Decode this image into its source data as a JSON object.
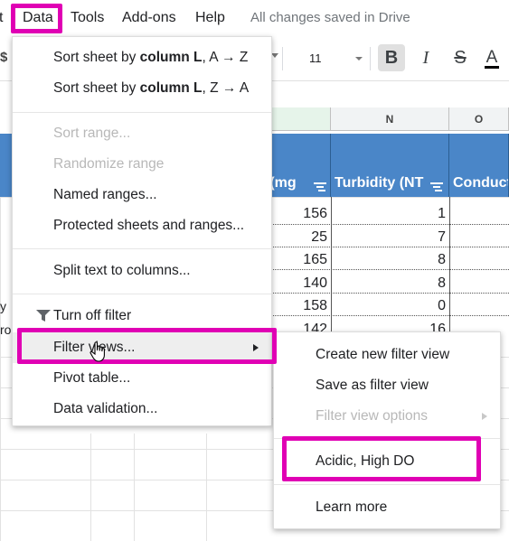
{
  "menubar": {
    "partial_left": "t",
    "items": [
      "Data",
      "Tools",
      "Add-ons",
      "Help"
    ],
    "status": "All changes saved in Drive"
  },
  "toolbar": {
    "currency": "$",
    "font_size": "11",
    "bold": "B",
    "italic": "I",
    "strike": "S",
    "text_color": "A"
  },
  "columns": {
    "n": "N",
    "o": "O"
  },
  "header_cells": {
    "m": "y (mg",
    "n": "Turbidity (NT",
    "o": "Conduct"
  },
  "rows": [
    {
      "m": "156",
      "n": "1",
      "label": ""
    },
    {
      "m": "25",
      "n": "7",
      "label": ""
    },
    {
      "m": "165",
      "n": "8",
      "label": ""
    },
    {
      "m": "140",
      "n": "8",
      "label": ""
    },
    {
      "m": "158",
      "n": "0",
      "label": "y"
    },
    {
      "m": "142",
      "n": "16",
      "label": "ro"
    }
  ],
  "data_menu": {
    "items": [
      {
        "pre": "Sort sheet by ",
        "bold": "column L",
        "post": ", A → Z",
        "disabled": false
      },
      {
        "pre": "Sort sheet by ",
        "bold": "column L",
        "post": ", Z → A",
        "disabled": false
      },
      {
        "label": "Sort range...",
        "disabled": true
      },
      {
        "label": "Randomize range",
        "disabled": true
      },
      {
        "label": "Named ranges...",
        "disabled": false
      },
      {
        "label": "Protected sheets and ranges...",
        "disabled": false
      },
      {
        "label": "Split text to columns...",
        "disabled": false
      },
      {
        "label": "Turn off filter",
        "disabled": false
      },
      {
        "label": "Filter views...",
        "disabled": false
      },
      {
        "label": "Pivot table...",
        "disabled": false
      },
      {
        "label": "Data validation...",
        "disabled": false
      }
    ]
  },
  "filter_views_submenu": {
    "items": [
      {
        "label": "Create new filter view",
        "disabled": false
      },
      {
        "label": "Save as filter view",
        "disabled": false
      },
      {
        "label": "Filter view options",
        "disabled": true
      },
      {
        "label": "Acidic, High DO",
        "disabled": false
      },
      {
        "label": "Learn more",
        "disabled": false
      }
    ]
  },
  "colors": {
    "highlight": "#e000b4",
    "header_fill": "#4a86c8",
    "selected_col": "#e6f4ea"
  }
}
